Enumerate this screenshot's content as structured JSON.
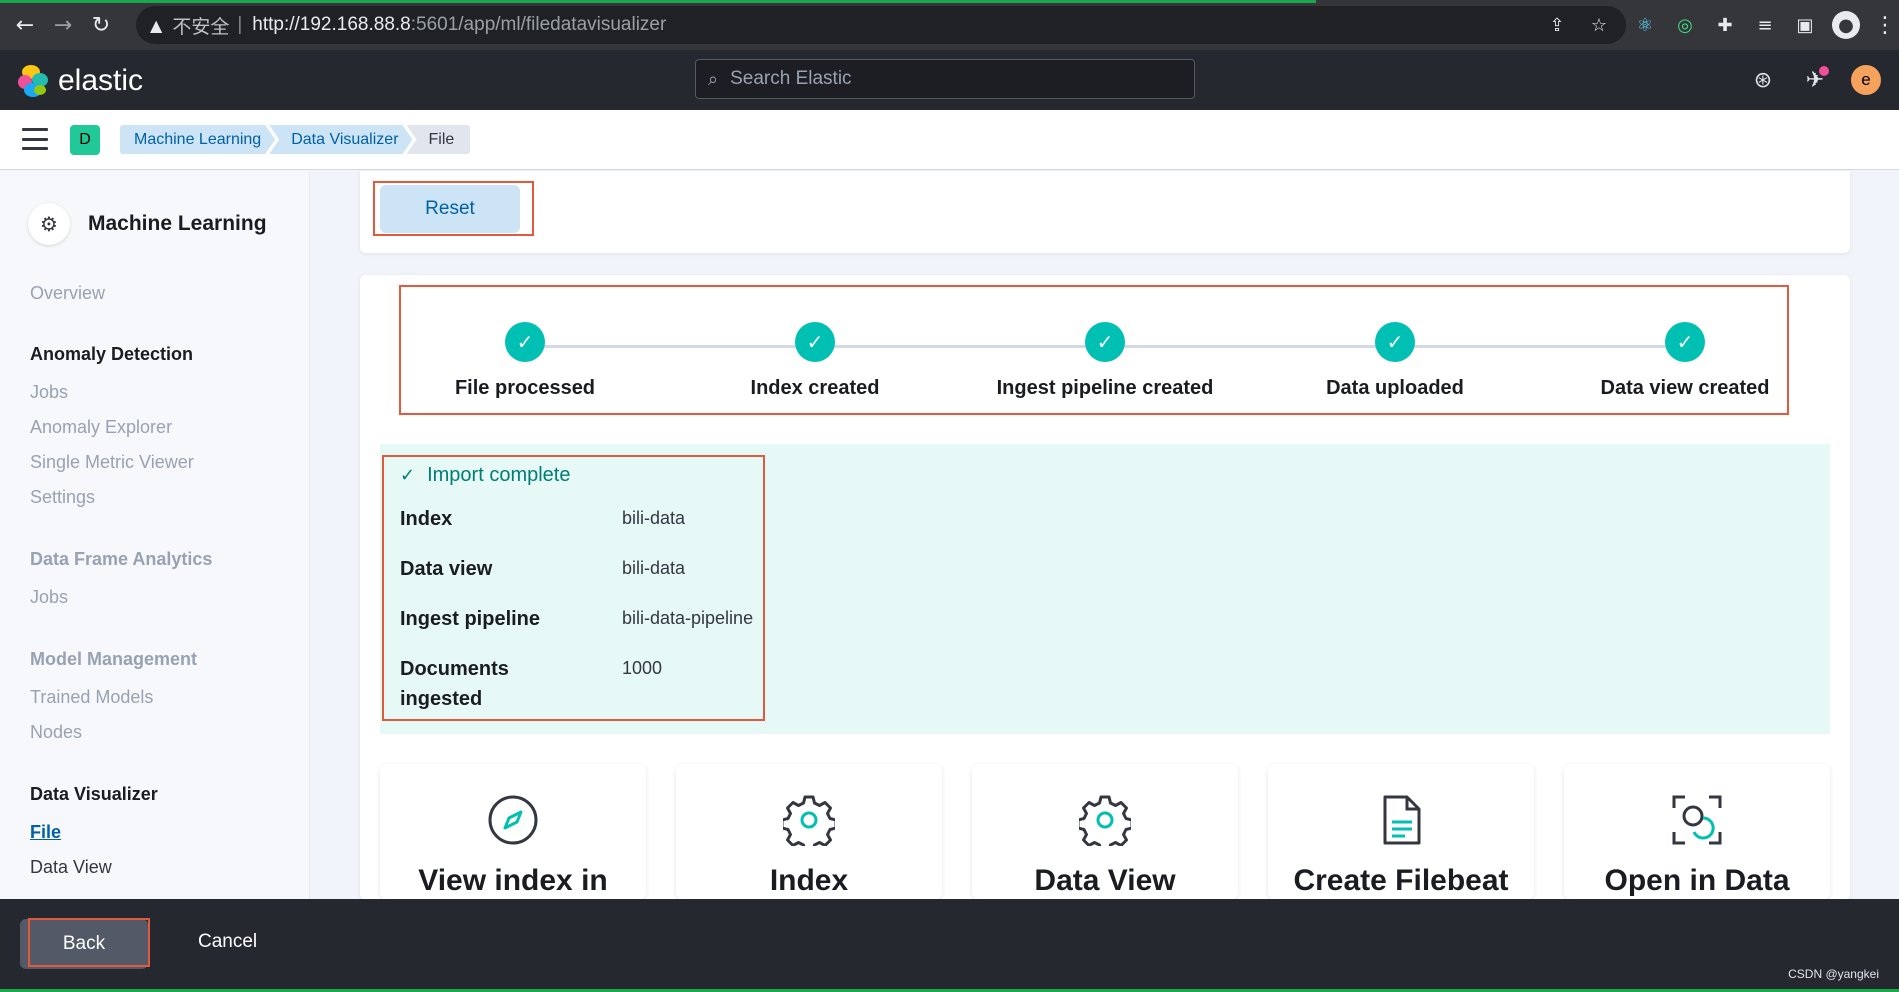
{
  "browser": {
    "insecure_label": "不安全",
    "separator": "|",
    "url_host": "http://192.168.88.8",
    "url_rest": ":5601/app/ml/filedatavisualizer"
  },
  "header": {
    "brand": "elastic",
    "search_placeholder": "Search Elastic",
    "avatar_letter": "e"
  },
  "breadcrumbs": {
    "space_letter": "D",
    "items": [
      "Machine Learning",
      "Data Visualizer",
      "File"
    ]
  },
  "sidebar": {
    "title": "Machine Learning",
    "overview": "Overview",
    "anomaly_detection": {
      "heading": "Anomaly Detection",
      "items": [
        "Jobs",
        "Anomaly Explorer",
        "Single Metric Viewer",
        "Settings"
      ]
    },
    "data_frame_analytics": {
      "heading": "Data Frame Analytics",
      "items": [
        "Jobs"
      ]
    },
    "model_management": {
      "heading": "Model Management",
      "items": [
        "Trained Models",
        "Nodes"
      ]
    },
    "data_visualizer": {
      "heading": "Data Visualizer",
      "items": [
        "File",
        "Data View"
      ]
    }
  },
  "main": {
    "reset_label": "Reset",
    "steps": [
      "File processed",
      "Index created",
      "Ingest pipeline created",
      "Data uploaded",
      "Data view created"
    ],
    "import": {
      "title": "Import complete",
      "rows": [
        {
          "key": "Index",
          "value": "bili-data"
        },
        {
          "key": "Data view",
          "value": "bili-data"
        },
        {
          "key": "Ingest pipeline",
          "value": "bili-data-pipeline"
        },
        {
          "key": "Documents ingested",
          "value": "1000"
        }
      ]
    },
    "cards": [
      "View index in",
      "Index",
      "Data View",
      "Create Filebeat",
      "Open in Data"
    ]
  },
  "footer": {
    "back_label": "Back",
    "cancel_label": "Cancel",
    "watermark": "CSDN @yangkei"
  },
  "colors": {
    "accent": "#00bfb3",
    "link": "#0061a6",
    "highlight_border": "#e25a3d"
  }
}
